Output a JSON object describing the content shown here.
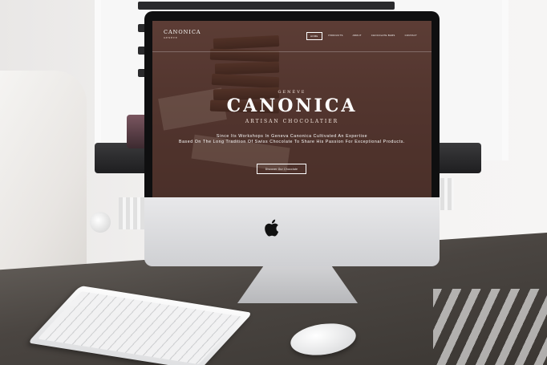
{
  "site": {
    "brand": "CANONICA",
    "brand_sub": "GENÈVE",
    "nav": [
      {
        "label": "HOME",
        "active": true
      },
      {
        "label": "PRODUCTS",
        "active": false
      },
      {
        "label": "ABOUT",
        "active": false
      },
      {
        "label": "CHOCOLATE BARS",
        "active": false
      },
      {
        "label": "CONTACT",
        "active": false
      }
    ],
    "hero": {
      "pre": "GENÈVE",
      "title": "CANONICA",
      "tagline": "ARTISAN CHOCOLATIER",
      "description_line1": "Since Its Workshops In Geneva Canonica Cultivated An Expertise",
      "description_line2": "Based On The Long Tradition Of Swiss Chocolate To Share His Passion For Exceptional Products.",
      "cta": "Discover Our Chocolate"
    }
  },
  "colors": {
    "hero_overlay": "#5b3c35",
    "text": "#ffffff"
  },
  "icons": {
    "logo": "apple-logo-icon"
  }
}
